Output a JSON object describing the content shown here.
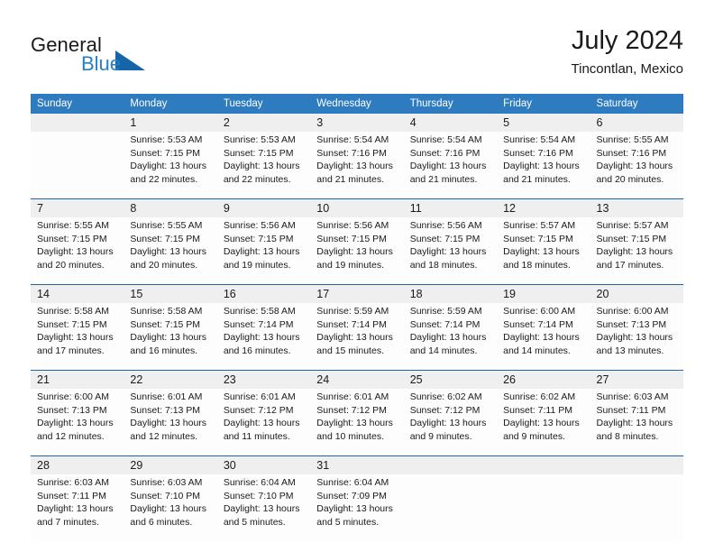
{
  "brand": {
    "name_part1": "General",
    "name_part2": "Blue",
    "triangle_color": "#1565a8",
    "blue_color": "#2581c4"
  },
  "header": {
    "title": "July 2024",
    "location": "Tincontlan, Mexico"
  },
  "calendar": {
    "header_bg": "#2e7cbf",
    "stripe_bg": "#efefef",
    "separator_color": "#2066a8",
    "weekdays": [
      "Sunday",
      "Monday",
      "Tuesday",
      "Wednesday",
      "Thursday",
      "Friday",
      "Saturday"
    ],
    "weeks": [
      [
        {
          "day": "",
          "sunrise": "",
          "sunset": "",
          "daylight_line1": "",
          "daylight_line2": ""
        },
        {
          "day": "1",
          "sunrise": "Sunrise: 5:53 AM",
          "sunset": "Sunset: 7:15 PM",
          "daylight_line1": "Daylight: 13 hours",
          "daylight_line2": "and 22 minutes."
        },
        {
          "day": "2",
          "sunrise": "Sunrise: 5:53 AM",
          "sunset": "Sunset: 7:15 PM",
          "daylight_line1": "Daylight: 13 hours",
          "daylight_line2": "and 22 minutes."
        },
        {
          "day": "3",
          "sunrise": "Sunrise: 5:54 AM",
          "sunset": "Sunset: 7:16 PM",
          "daylight_line1": "Daylight: 13 hours",
          "daylight_line2": "and 21 minutes."
        },
        {
          "day": "4",
          "sunrise": "Sunrise: 5:54 AM",
          "sunset": "Sunset: 7:16 PM",
          "daylight_line1": "Daylight: 13 hours",
          "daylight_line2": "and 21 minutes."
        },
        {
          "day": "5",
          "sunrise": "Sunrise: 5:54 AM",
          "sunset": "Sunset: 7:16 PM",
          "daylight_line1": "Daylight: 13 hours",
          "daylight_line2": "and 21 minutes."
        },
        {
          "day": "6",
          "sunrise": "Sunrise: 5:55 AM",
          "sunset": "Sunset: 7:16 PM",
          "daylight_line1": "Daylight: 13 hours",
          "daylight_line2": "and 20 minutes."
        }
      ],
      [
        {
          "day": "7",
          "sunrise": "Sunrise: 5:55 AM",
          "sunset": "Sunset: 7:15 PM",
          "daylight_line1": "Daylight: 13 hours",
          "daylight_line2": "and 20 minutes."
        },
        {
          "day": "8",
          "sunrise": "Sunrise: 5:55 AM",
          "sunset": "Sunset: 7:15 PM",
          "daylight_line1": "Daylight: 13 hours",
          "daylight_line2": "and 20 minutes."
        },
        {
          "day": "9",
          "sunrise": "Sunrise: 5:56 AM",
          "sunset": "Sunset: 7:15 PM",
          "daylight_line1": "Daylight: 13 hours",
          "daylight_line2": "and 19 minutes."
        },
        {
          "day": "10",
          "sunrise": "Sunrise: 5:56 AM",
          "sunset": "Sunset: 7:15 PM",
          "daylight_line1": "Daylight: 13 hours",
          "daylight_line2": "and 19 minutes."
        },
        {
          "day": "11",
          "sunrise": "Sunrise: 5:56 AM",
          "sunset": "Sunset: 7:15 PM",
          "daylight_line1": "Daylight: 13 hours",
          "daylight_line2": "and 18 minutes."
        },
        {
          "day": "12",
          "sunrise": "Sunrise: 5:57 AM",
          "sunset": "Sunset: 7:15 PM",
          "daylight_line1": "Daylight: 13 hours",
          "daylight_line2": "and 18 minutes."
        },
        {
          "day": "13",
          "sunrise": "Sunrise: 5:57 AM",
          "sunset": "Sunset: 7:15 PM",
          "daylight_line1": "Daylight: 13 hours",
          "daylight_line2": "and 17 minutes."
        }
      ],
      [
        {
          "day": "14",
          "sunrise": "Sunrise: 5:58 AM",
          "sunset": "Sunset: 7:15 PM",
          "daylight_line1": "Daylight: 13 hours",
          "daylight_line2": "and 17 minutes."
        },
        {
          "day": "15",
          "sunrise": "Sunrise: 5:58 AM",
          "sunset": "Sunset: 7:15 PM",
          "daylight_line1": "Daylight: 13 hours",
          "daylight_line2": "and 16 minutes."
        },
        {
          "day": "16",
          "sunrise": "Sunrise: 5:58 AM",
          "sunset": "Sunset: 7:14 PM",
          "daylight_line1": "Daylight: 13 hours",
          "daylight_line2": "and 16 minutes."
        },
        {
          "day": "17",
          "sunrise": "Sunrise: 5:59 AM",
          "sunset": "Sunset: 7:14 PM",
          "daylight_line1": "Daylight: 13 hours",
          "daylight_line2": "and 15 minutes."
        },
        {
          "day": "18",
          "sunrise": "Sunrise: 5:59 AM",
          "sunset": "Sunset: 7:14 PM",
          "daylight_line1": "Daylight: 13 hours",
          "daylight_line2": "and 14 minutes."
        },
        {
          "day": "19",
          "sunrise": "Sunrise: 6:00 AM",
          "sunset": "Sunset: 7:14 PM",
          "daylight_line1": "Daylight: 13 hours",
          "daylight_line2": "and 14 minutes."
        },
        {
          "day": "20",
          "sunrise": "Sunrise: 6:00 AM",
          "sunset": "Sunset: 7:13 PM",
          "daylight_line1": "Daylight: 13 hours",
          "daylight_line2": "and 13 minutes."
        }
      ],
      [
        {
          "day": "21",
          "sunrise": "Sunrise: 6:00 AM",
          "sunset": "Sunset: 7:13 PM",
          "daylight_line1": "Daylight: 13 hours",
          "daylight_line2": "and 12 minutes."
        },
        {
          "day": "22",
          "sunrise": "Sunrise: 6:01 AM",
          "sunset": "Sunset: 7:13 PM",
          "daylight_line1": "Daylight: 13 hours",
          "daylight_line2": "and 12 minutes."
        },
        {
          "day": "23",
          "sunrise": "Sunrise: 6:01 AM",
          "sunset": "Sunset: 7:12 PM",
          "daylight_line1": "Daylight: 13 hours",
          "daylight_line2": "and 11 minutes."
        },
        {
          "day": "24",
          "sunrise": "Sunrise: 6:01 AM",
          "sunset": "Sunset: 7:12 PM",
          "daylight_line1": "Daylight: 13 hours",
          "daylight_line2": "and 10 minutes."
        },
        {
          "day": "25",
          "sunrise": "Sunrise: 6:02 AM",
          "sunset": "Sunset: 7:12 PM",
          "daylight_line1": "Daylight: 13 hours",
          "daylight_line2": "and 9 minutes."
        },
        {
          "day": "26",
          "sunrise": "Sunrise: 6:02 AM",
          "sunset": "Sunset: 7:11 PM",
          "daylight_line1": "Daylight: 13 hours",
          "daylight_line2": "and 9 minutes."
        },
        {
          "day": "27",
          "sunrise": "Sunrise: 6:03 AM",
          "sunset": "Sunset: 7:11 PM",
          "daylight_line1": "Daylight: 13 hours",
          "daylight_line2": "and 8 minutes."
        }
      ],
      [
        {
          "day": "28",
          "sunrise": "Sunrise: 6:03 AM",
          "sunset": "Sunset: 7:11 PM",
          "daylight_line1": "Daylight: 13 hours",
          "daylight_line2": "and 7 minutes."
        },
        {
          "day": "29",
          "sunrise": "Sunrise: 6:03 AM",
          "sunset": "Sunset: 7:10 PM",
          "daylight_line1": "Daylight: 13 hours",
          "daylight_line2": "and 6 minutes."
        },
        {
          "day": "30",
          "sunrise": "Sunrise: 6:04 AM",
          "sunset": "Sunset: 7:10 PM",
          "daylight_line1": "Daylight: 13 hours",
          "daylight_line2": "and 5 minutes."
        },
        {
          "day": "31",
          "sunrise": "Sunrise: 6:04 AM",
          "sunset": "Sunset: 7:09 PM",
          "daylight_line1": "Daylight: 13 hours",
          "daylight_line2": "and 5 minutes."
        },
        {
          "day": "",
          "sunrise": "",
          "sunset": "",
          "daylight_line1": "",
          "daylight_line2": ""
        },
        {
          "day": "",
          "sunrise": "",
          "sunset": "",
          "daylight_line1": "",
          "daylight_line2": ""
        },
        {
          "day": "",
          "sunrise": "",
          "sunset": "",
          "daylight_line1": "",
          "daylight_line2": ""
        }
      ]
    ]
  }
}
